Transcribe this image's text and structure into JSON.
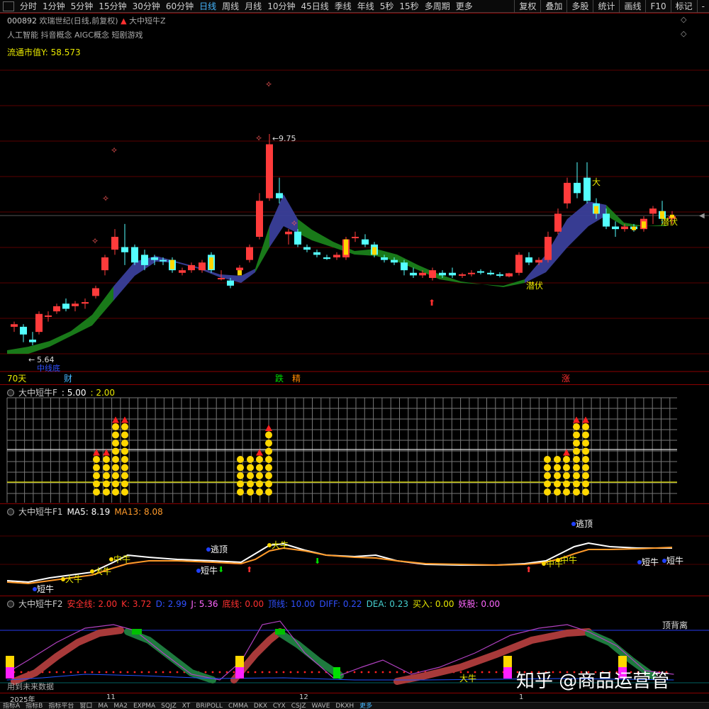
{
  "toolbar": {
    "items": [
      "分时",
      "1分钟",
      "5分钟",
      "15分钟",
      "30分钟",
      "60分钟",
      "日线",
      "周线",
      "月线",
      "10分钟",
      "45日线",
      "季线",
      "年线",
      "5秒",
      "15秒",
      "多周期",
      "更多"
    ],
    "active_index": 6,
    "right_items": [
      "复权",
      "叠加",
      "多股",
      "统计",
      "画线",
      "F10",
      "标记",
      "-"
    ]
  },
  "stock": {
    "code": "000892",
    "name": "欢瑞世纪",
    "mode": "(日线,前复权)",
    "indicator": "大中短牛Z",
    "concepts": "人工智能 抖音概念 AIGC概念 短剧游戏",
    "float_cap_label": "流通市值Y:",
    "float_cap_value": "58.573"
  },
  "main_chart": {
    "high_label": "9.75",
    "low_label": "5.64",
    "low_tag": "中线底",
    "tags": [
      {
        "text": "潜伏"
      },
      {
        "text": "潜伏"
      },
      {
        "text": "大"
      }
    ],
    "bottom_markers": [
      {
        "text": "70天",
        "color": "#e8e800"
      },
      {
        "text": "财",
        "color": "#46b7ff"
      },
      {
        "text": "跌",
        "color": "#00e000"
      },
      {
        "text": "精",
        "color": "#ff8800"
      },
      {
        "text": "涨",
        "color": "#ff3030"
      }
    ]
  },
  "panel1": {
    "title": "大中短牛F",
    "v1": ": 5.00",
    "v2": ": 2.00",
    "v1_color": "#ffffff",
    "v2_color": "#e8e800"
  },
  "panel2": {
    "title": "大中短牛F1",
    "ma5_label": "MA5: 8.19",
    "ma13_label": "MA13: 8.08",
    "labels": [
      {
        "text": "逃顶"
      },
      {
        "text": "逃顶"
      },
      {
        "text": "短牛"
      },
      {
        "text": "短牛"
      },
      {
        "text": "短牛"
      },
      {
        "text": "短牛"
      },
      {
        "text": "大牛"
      },
      {
        "text": "大牛"
      },
      {
        "text": "中牛"
      },
      {
        "text": "大牛"
      },
      {
        "text": "中牛"
      },
      {
        "text": "中牛"
      }
    ]
  },
  "panel3": {
    "title": "大中短牛F2",
    "fields": [
      {
        "label": "安全线: 2.00",
        "color": "#ff3030"
      },
      {
        "label": "K: 3.72",
        "color": "#ff3030"
      },
      {
        "label": "D: 2.99",
        "color": "#3050ff"
      },
      {
        "label": "J: 5.36",
        "color": "#ff66ff"
      },
      {
        "label": "底线: 0.00",
        "color": "#ff3030"
      },
      {
        "label": "顶线: 10.00",
        "color": "#3050ff"
      },
      {
        "label": "DIFF: 0.22",
        "color": "#3050ff"
      },
      {
        "label": "DEA: 0.23",
        "color": "#46d0d0"
      },
      {
        "label": "买入: 0.00",
        "color": "#e8e800"
      },
      {
        "label": "妖股: 0.00",
        "color": "#ff66ff"
      }
    ],
    "divergence_label": "顶背离",
    "future_label": "用到未来数据",
    "bull_label": "大牛"
  },
  "dates": {
    "year": "2025年",
    "m1": "11",
    "m2": "12",
    "m3": "1"
  },
  "bottom_bar": [
    "指标A",
    "指标B",
    "指标平台",
    "窗口",
    "MA",
    "MA2",
    "EXPMA",
    "SQJZ",
    "XT",
    "BRIPOLL",
    "CMMA",
    "DKX",
    "CYX",
    "CSJZ",
    "WAVE",
    "DKXH",
    "更多"
  ],
  "watermark": "知乎 @商品运营管",
  "colors": {
    "up": "#ff3b3b",
    "down": "#54ffff",
    "band_green": "#1a7f1a",
    "band_blue": "#3a3f9a",
    "grid_line": "#8b0000"
  }
}
